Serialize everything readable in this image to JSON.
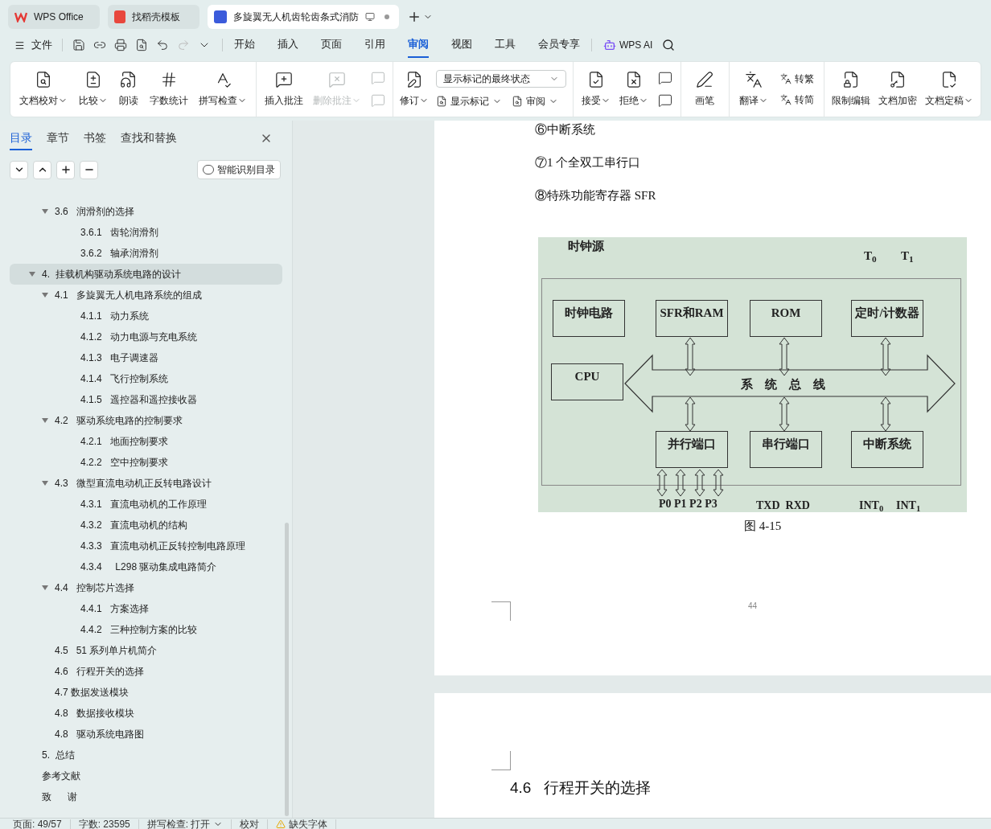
{
  "title_tabs": [
    {
      "title": "WPS Office",
      "selected": false
    },
    {
      "title": "找稻壳模板",
      "selected": false
    },
    {
      "title": "多旋翼无人机齿轮齿条式消防",
      "selected": true
    }
  ],
  "menu": {
    "file": "文件",
    "tabs": [
      {
        "label": "开始",
        "selected": false
      },
      {
        "label": "插入",
        "selected": false
      },
      {
        "label": "页面",
        "selected": false
      },
      {
        "label": "引用",
        "selected": false
      },
      {
        "label": "审阅",
        "selected": true
      },
      {
        "label": "视图",
        "selected": false
      },
      {
        "label": "工具",
        "selected": false
      },
      {
        "label": "会员专享",
        "selected": false
      }
    ],
    "ai": "WPS AI"
  },
  "ribbon": {
    "groups": [
      {
        "items": [
          {
            "kind": "large",
            "label": "文档校对",
            "dropdown": true,
            "disabled": false
          },
          {
            "kind": "large",
            "label": "比较",
            "dropdown": true,
            "disabled": false
          },
          {
            "kind": "large",
            "label": "朗读",
            "dropdown": false,
            "disabled": false
          },
          {
            "kind": "large",
            "label": "字数统计",
            "dropdown": false,
            "disabled": false
          },
          {
            "kind": "large",
            "label": "拼写检查",
            "dropdown": true,
            "disabled": false
          }
        ]
      },
      {
        "items": [
          {
            "kind": "large",
            "label": "插入批注",
            "dropdown": false,
            "disabled": false
          },
          {
            "kind": "large",
            "label": "删除批注",
            "dropdown": true,
            "disabled": true
          },
          {
            "kind": "nav",
            "disabled": true
          }
        ]
      },
      {
        "items": [
          {
            "kind": "large",
            "label": "修订",
            "dropdown": true,
            "disabled": false
          },
          {
            "kind": "stack",
            "rows": [
              {
                "kind": "select",
                "value": "显示标记的最终状态"
              },
              {
                "kind": "pair",
                "labels": [
                  {
                    "label": "显示标记",
                    "dropdown": true
                  },
                  {
                    "label": "审阅",
                    "dropdown": true
                  }
                ]
              }
            ]
          }
        ]
      },
      {
        "items": [
          {
            "kind": "large",
            "label": "接受",
            "dropdown": true,
            "disabled": false
          },
          {
            "kind": "large",
            "label": "拒绝",
            "dropdown": true,
            "disabled": false
          },
          {
            "kind": "nav",
            "disabled": false
          }
        ]
      },
      {
        "items": [
          {
            "kind": "large",
            "label": "画笔",
            "dropdown": false,
            "disabled": false
          }
        ]
      },
      {
        "items": [
          {
            "kind": "large",
            "label": "翻译",
            "dropdown": true,
            "disabled": false
          },
          {
            "kind": "stack",
            "rows": [
              {
                "kind": "small",
                "label": "转繁"
              },
              {
                "kind": "small",
                "label": "转简"
              }
            ]
          }
        ]
      },
      {
        "items": [
          {
            "kind": "large",
            "label": "限制编辑",
            "dropdown": false,
            "disabled": false
          },
          {
            "kind": "large",
            "label": "文档加密",
            "dropdown": false,
            "disabled": false
          },
          {
            "kind": "large",
            "label": "文档定稿",
            "dropdown": true,
            "disabled": false
          }
        ]
      }
    ]
  },
  "sidebar": {
    "tabs": [
      {
        "label": "目录",
        "selected": true
      },
      {
        "label": "章节",
        "selected": false
      },
      {
        "label": "书签",
        "selected": false
      },
      {
        "label": "查找和替换",
        "selected": false
      }
    ],
    "smart_button": "智能识别目录",
    "toc_continued": [
      {
        "text": "3.6   润滑剂的选择",
        "selected": false,
        "expanded": true,
        "children": [
          {
            "text": "3.6.1   齿轮润滑剂",
            "selected": false
          },
          {
            "text": "3.6.2   轴承润滑剂",
            "selected": false
          }
        ]
      }
    ],
    "toc": [
      {
        "text": "4.  挂载机构驱动系统电路的设计",
        "selected": true,
        "expanded": true,
        "children": [
          {
            "text": "4.1   多旋翼无人机电路系统的组成",
            "selected": false,
            "expanded": true,
            "children": [
              {
                "text": "4.1.1   动力系统",
                "selected": false
              },
              {
                "text": "4.1.2   动力电源与充电系统",
                "selected": false
              },
              {
                "text": "4.1.3   电子调速器",
                "selected": false
              },
              {
                "text": "4.1.4   飞行控制系统",
                "selected": false
              },
              {
                "text": "4.1.5   遥控器和遥控接收器",
                "selected": false
              }
            ]
          },
          {
            "text": "4.2   驱动系统电路的控制要求",
            "selected": false,
            "expanded": true,
            "children": [
              {
                "text": "4.2.1   地面控制要求",
                "selected": false
              },
              {
                "text": "4.2.2   空中控制要求",
                "selected": false
              }
            ]
          },
          {
            "text": "4.3   微型直流电动机正反转电路设计",
            "selected": false,
            "expanded": true,
            "children": [
              {
                "text": "4.3.1   直流电动机的工作原理",
                "selected": false
              },
              {
                "text": "4.3.2   直流电动机的结构",
                "selected": false
              },
              {
                "text": "4.3.3   直流电动机正反转控制电路原理",
                "selected": false
              },
              {
                "text": "4.3.4     L298 驱动集成电路简介",
                "selected": false
              }
            ]
          },
          {
            "text": "4.4   控制芯片选择",
            "selected": false,
            "expanded": true,
            "children": [
              {
                "text": "4.4.1   方案选择",
                "selected": false
              },
              {
                "text": "4.4.2   三种控制方案的比较",
                "selected": false
              }
            ]
          },
          {
            "text": "4.5   51 系列单片机简介",
            "selected": false
          },
          {
            "text": "4.6   行程开关的选择",
            "selected": false
          },
          {
            "text": "4.7 数据发送模块",
            "selected": false
          },
          {
            "text": "4.8   数据接收模块",
            "selected": false
          },
          {
            "text": "4.8   驱动系统电路图",
            "selected": false
          }
        ]
      },
      {
        "text": "5.  总结",
        "selected": false
      },
      {
        "text": "参考文献",
        "selected": false
      },
      {
        "text": "致      谢",
        "selected": false
      }
    ]
  },
  "document": {
    "paragraphs": [
      "⑥中断系统",
      "⑦1 个全双工串行口",
      "⑧特殊功能寄存器 SFR"
    ],
    "figure": {
      "clock_source": "时钟源",
      "timers": [
        "T$_{0}$",
        "T$_{1}$"
      ],
      "blocks": [
        "时钟电路",
        "SFR和RAM",
        "ROM",
        "定时/计数器",
        "CPU",
        "并行端口",
        "串行端口",
        "中断系统"
      ],
      "bus": "系　统　总　线",
      "ports": "P0 P1 P2 P3",
      "serial": "TXD  RXD",
      "interrupts": [
        "INT$_{0}$",
        "INT$_{1}$"
      ]
    },
    "caption": "图 4-15",
    "page_number": "44",
    "heading": "4.6   行程开关的选择"
  },
  "status_bar": [
    {
      "kind": "text",
      "text": "页面: 49/57",
      "dropdown": false
    },
    {
      "kind": "text",
      "text": "字数: 23595",
      "dropdown": false
    },
    {
      "kind": "text",
      "text": "拼写检查: 打开",
      "dropdown": true
    },
    {
      "kind": "text",
      "text": "校对",
      "dropdown": false
    },
    {
      "kind": "warning",
      "text": "缺失字体",
      "dropdown": false
    }
  ]
}
